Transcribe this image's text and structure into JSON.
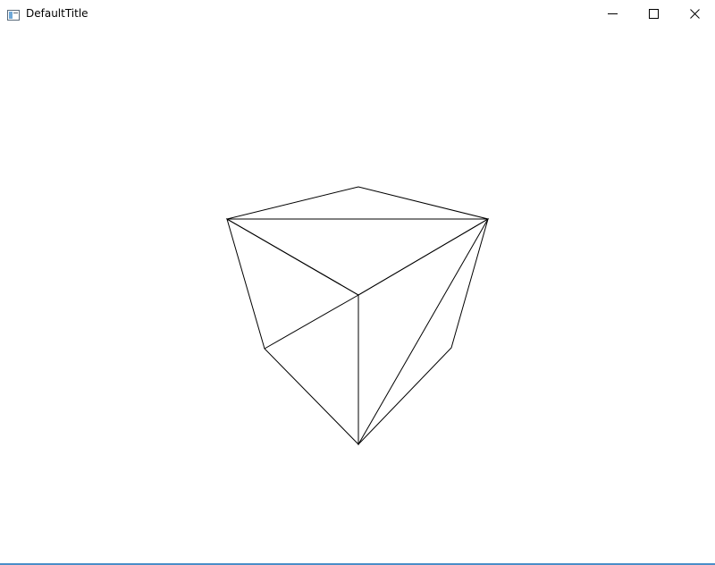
{
  "window": {
    "title": "DefaultTitle",
    "accent_color": "#4a8ec8"
  },
  "titlebar": {
    "app_icon": "window-app-icon",
    "minimize_icon": "minimize-icon",
    "maximize_icon": "maximize-icon",
    "close_icon": "close-icon"
  },
  "scene": {
    "content": "wireframe-cube",
    "line_color": "#000000",
    "background": "#ffffff"
  }
}
